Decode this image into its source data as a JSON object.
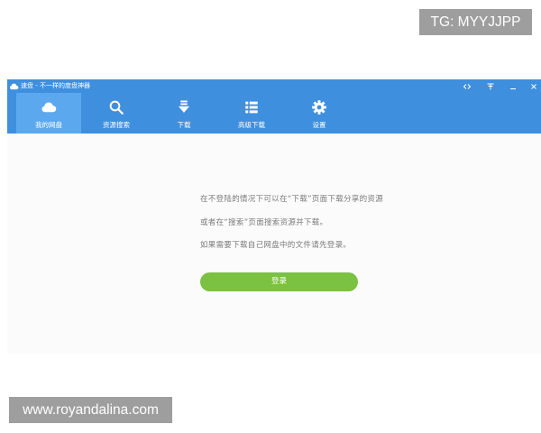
{
  "window": {
    "title": "速盘 - 不一样的度盘神器",
    "title_icon": "app-cloud-icon",
    "controls": [
      "feedback-icon",
      "pin-icon",
      "minimize-icon",
      "close-icon"
    ]
  },
  "toolbar": {
    "items": [
      {
        "label": "我的网盘",
        "icon": "cloud-icon",
        "selected": true
      },
      {
        "label": "资源搜索",
        "icon": "search-icon",
        "selected": false
      },
      {
        "label": "下载",
        "icon": "download-icon",
        "selected": false
      },
      {
        "label": "高级下载",
        "icon": "list-icon",
        "selected": false
      },
      {
        "label": "设置",
        "icon": "gear-icon",
        "selected": false
      }
    ]
  },
  "main": {
    "lines": [
      "在不登陆的情况下可以在“下载”页面下载分享的资源",
      "或者在“搜索”页面搜索资源并下载。",
      "如果需要下载自己网盘中的文件请先登录。"
    ],
    "login_button_label": "登录"
  },
  "watermarks": {
    "top_right": "TG: MYYJJPP",
    "bottom_left": "www.royandalina.com"
  },
  "colors": {
    "blue": "#3f8fdf",
    "blue_sel": "#5ca8ee",
    "green": "#7bc142",
    "wm_bg": "#9e9e9e",
    "text": "#7b7b7b"
  }
}
